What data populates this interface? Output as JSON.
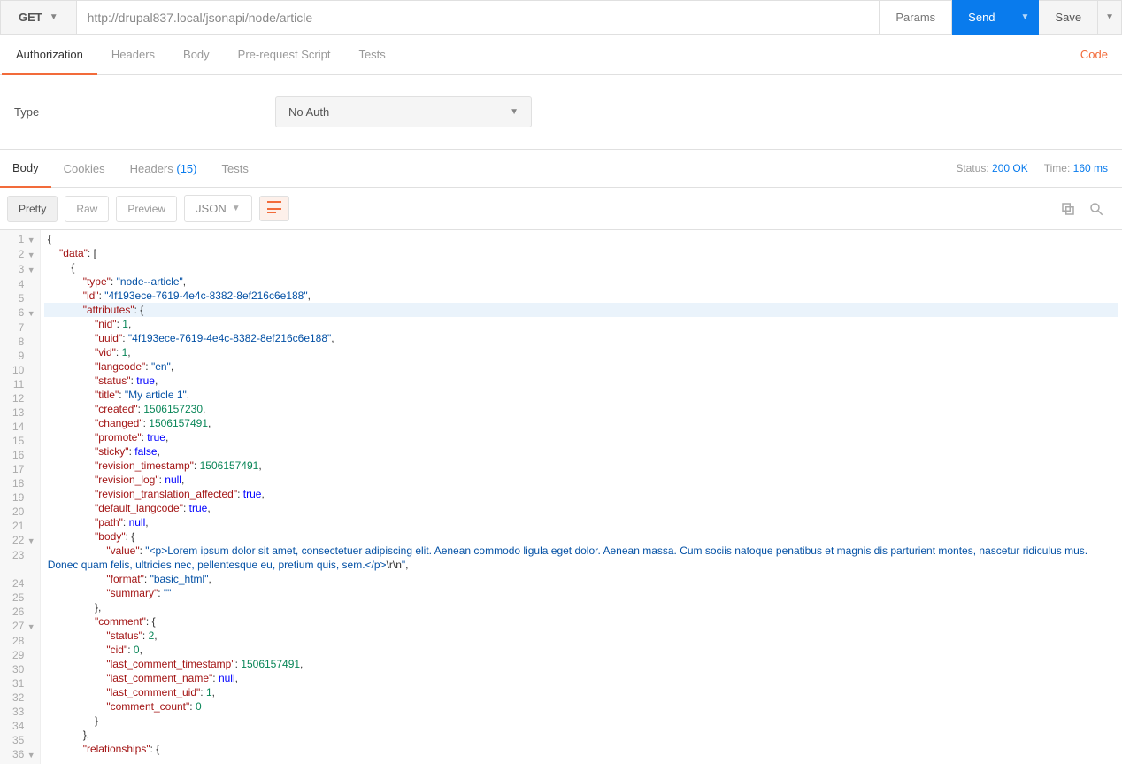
{
  "method": "GET",
  "url": "http://drupal837.local/jsonapi/node/article",
  "buttons": {
    "params": "Params",
    "send": "Send",
    "save": "Save"
  },
  "req_tabs": [
    "Authorization",
    "Headers",
    "Body",
    "Pre-request Script",
    "Tests"
  ],
  "code_link": "Code",
  "auth": {
    "label": "Type",
    "value": "No Auth"
  },
  "resp_tabs": {
    "body": "Body",
    "cookies": "Cookies",
    "headers": "Headers",
    "headers_count": "(15)",
    "tests": "Tests"
  },
  "status": {
    "label": "Status:",
    "value": "200 OK",
    "time_label": "Time:",
    "time_value": "160 ms"
  },
  "view": {
    "pretty": "Pretty",
    "raw": "Raw",
    "preview": "Preview",
    "format": "JSON"
  },
  "json_lines": [
    {
      "n": 1,
      "fold": true,
      "text": [
        [
          "p",
          "{"
        ]
      ]
    },
    {
      "n": 2,
      "fold": true,
      "indent": 1,
      "text": [
        [
          "k",
          "\"data\""
        ],
        [
          "p",
          ": ["
        ]
      ]
    },
    {
      "n": 3,
      "fold": true,
      "indent": 2,
      "text": [
        [
          "p",
          "{"
        ]
      ]
    },
    {
      "n": 4,
      "indent": 3,
      "text": [
        [
          "k",
          "\"type\""
        ],
        [
          "p",
          ": "
        ],
        [
          "s",
          "\"node--article\""
        ],
        [
          "p",
          ","
        ]
      ]
    },
    {
      "n": 5,
      "indent": 3,
      "text": [
        [
          "k",
          "\"id\""
        ],
        [
          "p",
          ": "
        ],
        [
          "s",
          "\"4f193ece-7619-4e4c-8382-8ef216c6e188\""
        ],
        [
          "p",
          ","
        ]
      ]
    },
    {
      "n": 6,
      "fold": true,
      "hl": true,
      "indent": 3,
      "text": [
        [
          "k",
          "\"attributes\""
        ],
        [
          "p",
          ": {"
        ]
      ]
    },
    {
      "n": 7,
      "indent": 4,
      "text": [
        [
          "k",
          "\"nid\""
        ],
        [
          "p",
          ": "
        ],
        [
          "n",
          "1"
        ],
        [
          "p",
          ","
        ]
      ]
    },
    {
      "n": 8,
      "indent": 4,
      "text": [
        [
          "k",
          "\"uuid\""
        ],
        [
          "p",
          ": "
        ],
        [
          "s",
          "\"4f193ece-7619-4e4c-8382-8ef216c6e188\""
        ],
        [
          "p",
          ","
        ]
      ]
    },
    {
      "n": 9,
      "indent": 4,
      "text": [
        [
          "k",
          "\"vid\""
        ],
        [
          "p",
          ": "
        ],
        [
          "n",
          "1"
        ],
        [
          "p",
          ","
        ]
      ]
    },
    {
      "n": 10,
      "indent": 4,
      "text": [
        [
          "k",
          "\"langcode\""
        ],
        [
          "p",
          ": "
        ],
        [
          "s",
          "\"en\""
        ],
        [
          "p",
          ","
        ]
      ]
    },
    {
      "n": 11,
      "indent": 4,
      "text": [
        [
          "k",
          "\"status\""
        ],
        [
          "p",
          ": "
        ],
        [
          "b",
          "true"
        ],
        [
          "p",
          ","
        ]
      ]
    },
    {
      "n": 12,
      "indent": 4,
      "text": [
        [
          "k",
          "\"title\""
        ],
        [
          "p",
          ": "
        ],
        [
          "s",
          "\"My article 1\""
        ],
        [
          "p",
          ","
        ]
      ]
    },
    {
      "n": 13,
      "indent": 4,
      "text": [
        [
          "k",
          "\"created\""
        ],
        [
          "p",
          ": "
        ],
        [
          "n",
          "1506157230"
        ],
        [
          "p",
          ","
        ]
      ]
    },
    {
      "n": 14,
      "indent": 4,
      "text": [
        [
          "k",
          "\"changed\""
        ],
        [
          "p",
          ": "
        ],
        [
          "n",
          "1506157491"
        ],
        [
          "p",
          ","
        ]
      ]
    },
    {
      "n": 15,
      "indent": 4,
      "text": [
        [
          "k",
          "\"promote\""
        ],
        [
          "p",
          ": "
        ],
        [
          "b",
          "true"
        ],
        [
          "p",
          ","
        ]
      ]
    },
    {
      "n": 16,
      "indent": 4,
      "text": [
        [
          "k",
          "\"sticky\""
        ],
        [
          "p",
          ": "
        ],
        [
          "b",
          "false"
        ],
        [
          "p",
          ","
        ]
      ]
    },
    {
      "n": 17,
      "indent": 4,
      "text": [
        [
          "k",
          "\"revision_timestamp\""
        ],
        [
          "p",
          ": "
        ],
        [
          "n",
          "1506157491"
        ],
        [
          "p",
          ","
        ]
      ]
    },
    {
      "n": 18,
      "indent": 4,
      "text": [
        [
          "k",
          "\"revision_log\""
        ],
        [
          "p",
          ": "
        ],
        [
          "nl",
          "null"
        ],
        [
          "p",
          ","
        ]
      ]
    },
    {
      "n": 19,
      "indent": 4,
      "text": [
        [
          "k",
          "\"revision_translation_affected\""
        ],
        [
          "p",
          ": "
        ],
        [
          "b",
          "true"
        ],
        [
          "p",
          ","
        ]
      ]
    },
    {
      "n": 20,
      "indent": 4,
      "text": [
        [
          "k",
          "\"default_langcode\""
        ],
        [
          "p",
          ": "
        ],
        [
          "b",
          "true"
        ],
        [
          "p",
          ","
        ]
      ]
    },
    {
      "n": 21,
      "indent": 4,
      "text": [
        [
          "k",
          "\"path\""
        ],
        [
          "p",
          ": "
        ],
        [
          "nl",
          "null"
        ],
        [
          "p",
          ","
        ]
      ]
    },
    {
      "n": 22,
      "fold": true,
      "indent": 4,
      "text": [
        [
          "k",
          "\"body\""
        ],
        [
          "p",
          ": {"
        ]
      ]
    },
    {
      "n": 23,
      "indent": 5,
      "wrap": true,
      "text": [
        [
          "k",
          "\"value\""
        ],
        [
          "p",
          ": "
        ],
        [
          "s",
          "\"<p>Lorem ipsum dolor sit amet, consectetuer adipiscing elit. Aenean commodo ligula eget dolor. Aenean massa. Cum sociis natoque penatibus et magnis dis parturient montes, nascetur ridiculus mus. Donec quam felis, ultricies nec, pellentesque eu, pretium quis, sem.</p>"
        ],
        [
          "p",
          "\\r\\n"
        ],
        [
          "s",
          "\""
        ],
        [
          "p",
          ","
        ]
      ]
    },
    {
      "n": 24,
      "indent": 5,
      "text": [
        [
          "k",
          "\"format\""
        ],
        [
          "p",
          ": "
        ],
        [
          "s",
          "\"basic_html\""
        ],
        [
          "p",
          ","
        ]
      ]
    },
    {
      "n": 25,
      "indent": 5,
      "text": [
        [
          "k",
          "\"summary\""
        ],
        [
          "p",
          ": "
        ],
        [
          "s",
          "\"\""
        ]
      ]
    },
    {
      "n": 26,
      "indent": 4,
      "text": [
        [
          "p",
          "},"
        ]
      ]
    },
    {
      "n": 27,
      "fold": true,
      "indent": 4,
      "text": [
        [
          "k",
          "\"comment\""
        ],
        [
          "p",
          ": {"
        ]
      ]
    },
    {
      "n": 28,
      "indent": 5,
      "text": [
        [
          "k",
          "\"status\""
        ],
        [
          "p",
          ": "
        ],
        [
          "n",
          "2"
        ],
        [
          "p",
          ","
        ]
      ]
    },
    {
      "n": 29,
      "indent": 5,
      "text": [
        [
          "k",
          "\"cid\""
        ],
        [
          "p",
          ": "
        ],
        [
          "n",
          "0"
        ],
        [
          "p",
          ","
        ]
      ]
    },
    {
      "n": 30,
      "indent": 5,
      "text": [
        [
          "k",
          "\"last_comment_timestamp\""
        ],
        [
          "p",
          ": "
        ],
        [
          "n",
          "1506157491"
        ],
        [
          "p",
          ","
        ]
      ]
    },
    {
      "n": 31,
      "indent": 5,
      "text": [
        [
          "k",
          "\"last_comment_name\""
        ],
        [
          "p",
          ": "
        ],
        [
          "nl",
          "null"
        ],
        [
          "p",
          ","
        ]
      ]
    },
    {
      "n": 32,
      "indent": 5,
      "text": [
        [
          "k",
          "\"last_comment_uid\""
        ],
        [
          "p",
          ": "
        ],
        [
          "n",
          "1"
        ],
        [
          "p",
          ","
        ]
      ]
    },
    {
      "n": 33,
      "indent": 5,
      "text": [
        [
          "k",
          "\"comment_count\""
        ],
        [
          "p",
          ": "
        ],
        [
          "n",
          "0"
        ]
      ]
    },
    {
      "n": 34,
      "indent": 4,
      "text": [
        [
          "p",
          "}"
        ]
      ]
    },
    {
      "n": 35,
      "indent": 3,
      "text": [
        [
          "p",
          "},"
        ]
      ]
    },
    {
      "n": 36,
      "fold": true,
      "indent": 3,
      "text": [
        [
          "k",
          "\"relationships\""
        ],
        [
          "p",
          ": {"
        ]
      ]
    }
  ]
}
